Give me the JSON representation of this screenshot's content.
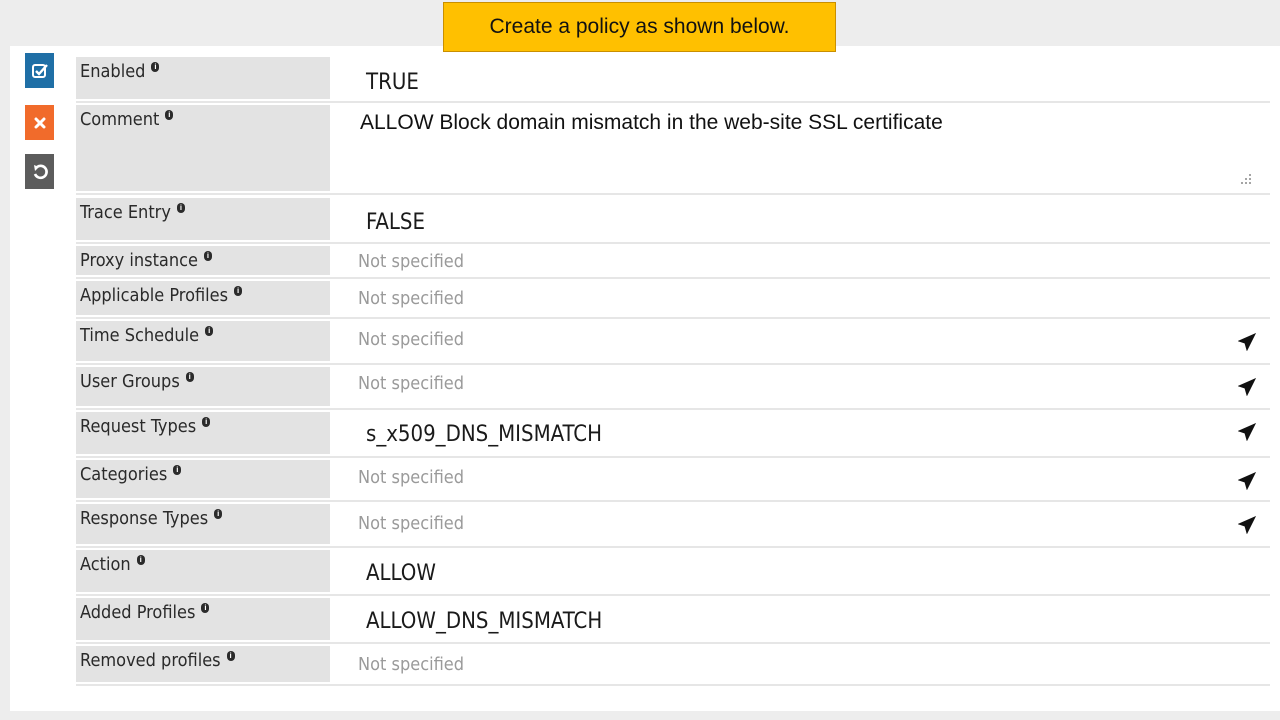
{
  "banner": {
    "text": "Create a policy as shown below."
  },
  "sidebar": {
    "save_icon": "checkbox-icon",
    "cancel_icon": "close-icon",
    "reset_icon": "undo-icon",
    "colors": {
      "save": "#1f6fa6",
      "cancel": "#f16b2b",
      "reset": "#5c5c5c"
    }
  },
  "info_icon": "i",
  "fields": {
    "enabled": {
      "label": "Enabled",
      "value": "TRUE"
    },
    "comment": {
      "label": "Comment",
      "value": "ALLOW Block domain mismatch in the web-site SSL certificate"
    },
    "trace_entry": {
      "label": "Trace Entry",
      "value": "FALSE"
    },
    "proxy_instance": {
      "label": "Proxy instance",
      "value": "Not specified"
    },
    "applicable_profiles": {
      "label": "Applicable Profiles",
      "value": "Not specified"
    },
    "time_schedule": {
      "label": "Time Schedule",
      "value": "Not specified"
    },
    "user_groups": {
      "label": "User Groups",
      "value": "Not specified"
    },
    "request_types": {
      "label": "Request Types",
      "value": "s_x509_DNS_MISMATCH"
    },
    "categories": {
      "label": "Categories",
      "value": "Not specified"
    },
    "response_types": {
      "label": "Response Types",
      "value": "Not specified"
    },
    "action": {
      "label": "Action",
      "value": "ALLOW"
    },
    "added_profiles": {
      "label": "Added Profiles",
      "value": "ALLOW_DNS_MISMATCH"
    },
    "removed_profiles": {
      "label": "Removed profiles",
      "value": "Not specified"
    }
  },
  "edit_icon": "paper-plane-icon"
}
